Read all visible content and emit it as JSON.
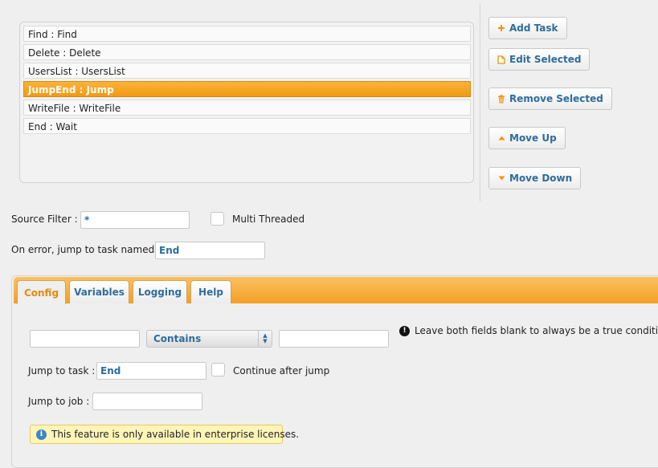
{
  "tasks": [
    {
      "label": "Find : Find",
      "selected": false
    },
    {
      "label": "Delete : Delete",
      "selected": false
    },
    {
      "label": "UsersList : UsersList",
      "selected": false
    },
    {
      "label": "JumpEnd : Jump",
      "selected": true
    },
    {
      "label": "WriteFile : WriteFile",
      "selected": false
    },
    {
      "label": "End : Wait",
      "selected": false
    }
  ],
  "actions": {
    "add_task": {
      "label": "Add Task",
      "icon": "plus-icon"
    },
    "edit_selected": {
      "label": "Edit Selected",
      "icon": "document-icon"
    },
    "remove_selected": {
      "label": "Remove Selected",
      "icon": "trash-icon"
    },
    "move_up": {
      "label": "Move Up",
      "icon": "triangle-up-icon"
    },
    "move_down": {
      "label": "Move Down",
      "icon": "triangle-down-icon"
    }
  },
  "source_filter": {
    "label": "Source Filter :",
    "value": "*"
  },
  "multi_threaded": {
    "label": "Multi Threaded",
    "checked": false
  },
  "on_error": {
    "label": "On error, jump to task named :",
    "value": "End"
  },
  "tabs": [
    {
      "label": "Config",
      "active": true
    },
    {
      "label": "Variables",
      "active": false
    },
    {
      "label": "Logging",
      "active": false
    },
    {
      "label": "Help",
      "active": false
    }
  ],
  "config": {
    "condition": {
      "left_value": "",
      "operator": "Contains",
      "right_value": "",
      "hint": "Leave both fields blank to always be a true condition."
    },
    "jump_to_task": {
      "label": "Jump to task :",
      "value": "End"
    },
    "continue_after_jump": {
      "label": "Continue after jump",
      "checked": false
    },
    "jump_to_job": {
      "label": "Jump to job :",
      "value": ""
    },
    "notice": "This feature is only available in enterprise licenses."
  },
  "colors": {
    "accent": "#f4a024",
    "link_blue": "#2d6d9e",
    "notice_bg": "#fff5b8",
    "info_blue": "#3a87c8"
  }
}
